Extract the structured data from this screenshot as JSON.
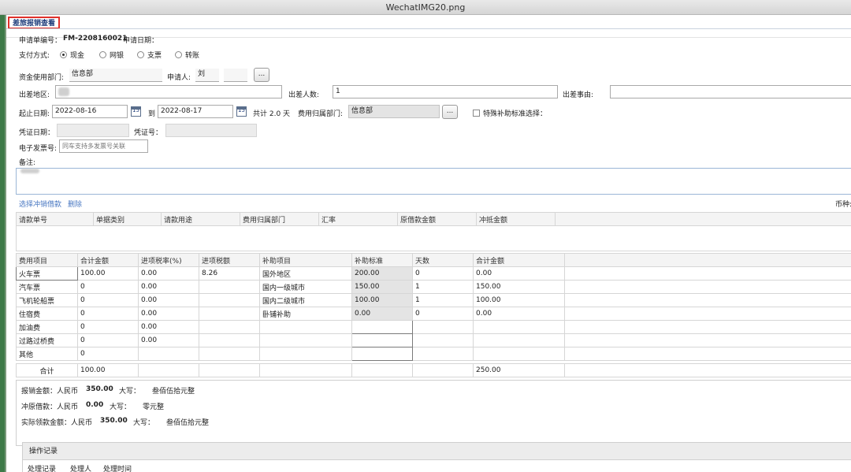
{
  "window": {
    "title": "WechatIMG20.png"
  },
  "tab": {
    "title": "差旅报销查看"
  },
  "form": {
    "app_no_label": "申请单编号：",
    "app_no_value": "FM-2208160021",
    "app_date_label": "申请日期：",
    "pay_label": "支付方式:",
    "pay_options": [
      "现金",
      "网银",
      "支票",
      "转账"
    ],
    "pay_selected": "现金",
    "dept_label": "资金使用部门:",
    "dept_value": "信息部",
    "applicant_label": "申请人:",
    "applicant_value": "刘",
    "browse_label": "...",
    "area_label": "出差地区:",
    "people_label": "出差人数:",
    "people_value": "1",
    "reason_label": "出差事由:",
    "start_label": "起止日期:",
    "start_value": "2022-08-16",
    "to_label": "到",
    "end_value": "2022-08-17",
    "cal_label": "15",
    "total_days": "共计 2.0 天",
    "cost_dept_label": "费用归属部门:",
    "cost_dept_value": "信息部",
    "special_label": "特殊补助标准选择：",
    "voucher_date_label": "凭证日期：",
    "voucher_no_label": "凭证号：",
    "einvoice_label": "电子发票号:",
    "einvoice_placeholder": "同车支持多发票号关联",
    "remark_label": "备注:"
  },
  "loan": {
    "select_link": "选择冲销借款",
    "delete_link": "删除",
    "currency_label": "币种:",
    "headers": [
      "请款单号",
      "单据类别",
      "请款用途",
      "费用归属部门",
      "汇率",
      "原借款金额",
      "冲抵金额"
    ]
  },
  "expense": {
    "headers": [
      "费用项目",
      "合计金额",
      "进项税率(%)",
      "进项税额"
    ],
    "rows": [
      {
        "item": "火车票",
        "amount": "100.00",
        "rate": "0.00",
        "tax": "8.26"
      },
      {
        "item": "汽车票",
        "amount": "0",
        "rate": "0.00",
        "tax": ""
      },
      {
        "item": "飞机轮船票",
        "amount": "0",
        "rate": "0.00",
        "tax": ""
      },
      {
        "item": "住宿费",
        "amount": "0",
        "rate": "0.00",
        "tax": ""
      },
      {
        "item": "加油费",
        "amount": "0",
        "rate": "0.00",
        "tax": ""
      },
      {
        "item": "过路过桥费",
        "amount": "0",
        "rate": "0.00",
        "tax": ""
      },
      {
        "item": "其他",
        "amount": "0",
        "rate": "",
        "tax": ""
      }
    ],
    "total_label": "合计",
    "total_amount": "100.00"
  },
  "subsidy": {
    "headers": [
      "补助项目",
      "补助标准",
      "天数",
      "合计金额"
    ],
    "rows": [
      {
        "item": "国外地区",
        "std": "200.00",
        "days": "0",
        "total": "0.00"
      },
      {
        "item": "国内一级城市",
        "std": "150.00",
        "days": "1",
        "total": "150.00"
      },
      {
        "item": "国内二级城市",
        "std": "100.00",
        "days": "1",
        "total": "100.00"
      },
      {
        "item": "卧铺补助",
        "std": "0.00",
        "days": "0",
        "total": "0.00"
      },
      {
        "item": "",
        "std": "",
        "days": "",
        "total": ""
      },
      {
        "item": "",
        "std": "",
        "days": "",
        "total": ""
      },
      {
        "item": "",
        "std": "",
        "days": "",
        "total": ""
      }
    ],
    "total_amount": "250.00"
  },
  "summary": {
    "reimb_label": "报销金额：人民币",
    "reimb_value": "350.00",
    "reimb_cap_label": "大写：",
    "reimb_cap": "叁佰伍拾元整",
    "offset_label": "冲原借款：人民币",
    "offset_value": "0.00",
    "offset_cap_label": "大写：",
    "offset_cap": "零元整",
    "actual_label": "实际领款金额：人民币",
    "actual_value": "350.00",
    "actual_cap_label": "大写：",
    "actual_cap": "叁佰伍拾元整"
  },
  "ops": {
    "title": "操作记录",
    "headers": [
      "处理记录",
      "处理人",
      "处理时间"
    ]
  }
}
